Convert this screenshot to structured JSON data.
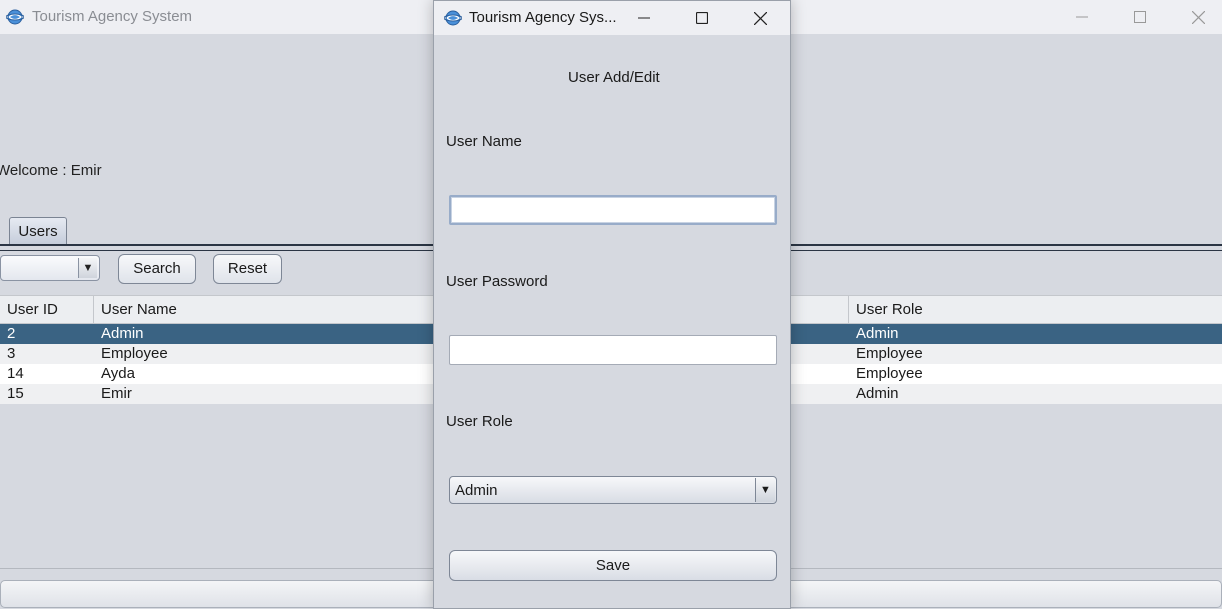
{
  "main_window": {
    "title": "Tourism Agency System",
    "welcome": "Welcome : Emir",
    "tab": "Users",
    "search_button": "Search",
    "reset_button": "Reset",
    "table": {
      "columns": [
        "User ID",
        "User Name",
        "User Role"
      ],
      "rows": [
        {
          "id": "2",
          "name": "Admin",
          "role": "Admin",
          "selected": true
        },
        {
          "id": "3",
          "name": "Employee",
          "role": "Employee"
        },
        {
          "id": "14",
          "name": "Ayda",
          "role": "Employee"
        },
        {
          "id": "15",
          "name": "Emir",
          "role": "Admin"
        }
      ]
    }
  },
  "dialog": {
    "title": "Tourism Agency Sys...",
    "heading": "User Add/Edit",
    "username_label": "User Name",
    "username_value": "",
    "password_label": "User Password",
    "password_value": "",
    "role_label": "User Role",
    "role_selected": "Admin",
    "save_button": "Save"
  },
  "icons": {
    "app": "globe-icon",
    "minimize": "minimize-icon",
    "maximize": "maximize-icon",
    "close": "close-icon",
    "dropdown": "chevron-down-icon"
  },
  "colors": {
    "selection": "#3a6383",
    "background": "#d6d9e0"
  }
}
